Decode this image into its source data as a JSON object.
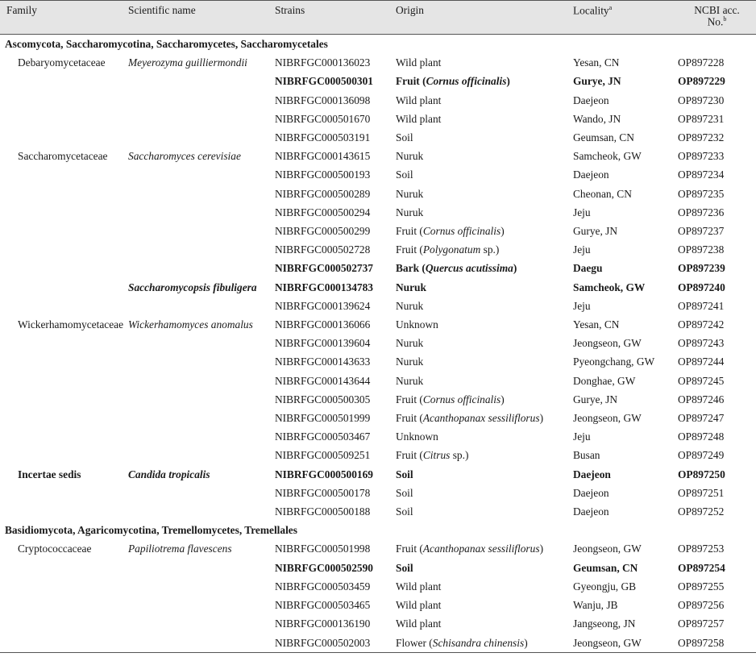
{
  "headers": {
    "family": "Family",
    "scientific": "Scientific name",
    "strains": "Strains",
    "origin": "Origin",
    "locality": "Locality",
    "locality_sup": "a",
    "ncbi_line1": "NCBI acc.",
    "ncbi_line2": "No.",
    "ncbi_sup": "b"
  },
  "groups": {
    "g1": "Ascomycota, Saccharomycotina, Saccharomycetes, Saccharomycetales",
    "g2": "Basidiomycota, Agaricomycotina, Tremellomycetes, Tremellales"
  },
  "rows": [
    {
      "family": "Debaryomycetaceae",
      "scientific": "Meyerozyma guilliermondii",
      "strain": "NIBRFGC000136023",
      "origin": "Wild plant",
      "origin_sp": "",
      "origin_end": "",
      "locality": "Yesan, CN",
      "acc": "OP897228"
    },
    {
      "family": "",
      "scientific": "",
      "strain": "NIBRFGC000500301",
      "origin": "Fruit (",
      "origin_sp": "Cornus officinalis",
      "origin_end": ")",
      "locality": "Gurye, JN",
      "acc": "OP897229"
    },
    {
      "family": "",
      "scientific": "",
      "strain": "NIBRFGC000136098",
      "origin": "Wild plant",
      "origin_sp": "",
      "origin_end": "",
      "locality": "Daejeon",
      "acc": "OP897230"
    },
    {
      "family": "",
      "scientific": "",
      "strain": "NIBRFGC000501670",
      "origin": "Wild plant",
      "origin_sp": "",
      "origin_end": "",
      "locality": "Wando, JN",
      "acc": "OP897231"
    },
    {
      "family": "",
      "scientific": "",
      "strain": "NIBRFGC000503191",
      "origin": "Soil",
      "origin_sp": "",
      "origin_end": "",
      "locality": "Geumsan, CN",
      "acc": "OP897232"
    },
    {
      "family": "Saccharomycetaceae",
      "scientific": "Saccharomyces cerevisiae",
      "strain": "NIBRFGC000143615",
      "origin": "Nuruk",
      "origin_sp": "",
      "origin_end": "",
      "locality": "Samcheok, GW",
      "acc": "OP897233"
    },
    {
      "family": "",
      "scientific": "",
      "strain": "NIBRFGC000500193",
      "origin": "Soil",
      "origin_sp": "",
      "origin_end": "",
      "locality": "Daejeon",
      "acc": "OP897234"
    },
    {
      "family": "",
      "scientific": "",
      "strain": "NIBRFGC000500289",
      "origin": "Nuruk",
      "origin_sp": "",
      "origin_end": "",
      "locality": "Cheonan, CN",
      "acc": "OP897235"
    },
    {
      "family": "",
      "scientific": "",
      "strain": "NIBRFGC000500294",
      "origin": "Nuruk",
      "origin_sp": "",
      "origin_end": "",
      "locality": "Jeju",
      "acc": "OP897236"
    },
    {
      "family": "",
      "scientific": "",
      "strain": "NIBRFGC000500299",
      "origin": "Fruit (",
      "origin_sp": "Cornus officinalis",
      "origin_end": ")",
      "locality": "Gurye, JN",
      "acc": "OP897237"
    },
    {
      "family": "",
      "scientific": "",
      "strain": "NIBRFGC000502728",
      "origin": "Fruit (",
      "origin_sp": "Polygonatum",
      "origin_end": " sp.)",
      "locality": "Jeju",
      "acc": "OP897238"
    },
    {
      "family": "",
      "scientific": "",
      "strain": "NIBRFGC000502737",
      "origin": "Bark (",
      "origin_sp": "Quercus acutissima",
      "origin_end": ")",
      "locality": "Daegu",
      "acc": "OP897239"
    },
    {
      "family": "",
      "scientific": "Saccharomycopsis fibuligera",
      "strain": "NIBRFGC000134783",
      "origin": "Nuruk",
      "origin_sp": "",
      "origin_end": "",
      "locality": "Samcheok, GW",
      "acc": "OP897240"
    },
    {
      "family": "",
      "scientific": "",
      "strain": "NIBRFGC000139624",
      "origin": "Nuruk",
      "origin_sp": "",
      "origin_end": "",
      "locality": "Jeju",
      "acc": "OP897241"
    },
    {
      "family": "Wickerhamomycetaceae",
      "scientific": "Wickerhamomyces anomalus",
      "strain": "NIBRFGC000136066",
      "origin": "Unknown",
      "origin_sp": "",
      "origin_end": "",
      "locality": "Yesan, CN",
      "acc": "OP897242"
    },
    {
      "family": "",
      "scientific": "",
      "strain": "NIBRFGC000139604",
      "origin": "Nuruk",
      "origin_sp": "",
      "origin_end": "",
      "locality": "Jeongseon, GW",
      "acc": "OP897243"
    },
    {
      "family": "",
      "scientific": "",
      "strain": "NIBRFGC000143633",
      "origin": "Nuruk",
      "origin_sp": "",
      "origin_end": "",
      "locality": "Pyeongchang, GW",
      "acc": "OP897244"
    },
    {
      "family": "",
      "scientific": "",
      "strain": "NIBRFGC000143644",
      "origin": "Nuruk",
      "origin_sp": "",
      "origin_end": "",
      "locality": "Donghae, GW",
      "acc": "OP897245"
    },
    {
      "family": "",
      "scientific": "",
      "strain": "NIBRFGC000500305",
      "origin": "Fruit (",
      "origin_sp": "Cornus officinalis",
      "origin_end": ")",
      "locality": "Gurye, JN",
      "acc": "OP897246"
    },
    {
      "family": "",
      "scientific": "",
      "strain": "NIBRFGC000501999",
      "origin": "Fruit (",
      "origin_sp": "Acanthopanax sessiliflorus",
      "origin_end": ")",
      "locality": "Jeongseon, GW",
      "acc": "OP897247"
    },
    {
      "family": "",
      "scientific": "",
      "strain": "NIBRFGC000503467",
      "origin": "Unknown",
      "origin_sp": "",
      "origin_end": "",
      "locality": "Jeju",
      "acc": "OP897248"
    },
    {
      "family": "",
      "scientific": "",
      "strain": "NIBRFGC000509251",
      "origin": "Fruit (",
      "origin_sp": "Citrus",
      "origin_end": " sp.)",
      "locality": "Busan",
      "acc": "OP897249"
    },
    {
      "family": "Incertae sedis",
      "scientific": "Candida tropicalis",
      "strain": "NIBRFGC000500169",
      "origin": "Soil",
      "origin_sp": "",
      "origin_end": "",
      "locality": "Daejeon",
      "acc": "OP897250"
    },
    {
      "family": "",
      "scientific": "",
      "strain": "NIBRFGC000500178",
      "origin": "Soil",
      "origin_sp": "",
      "origin_end": "",
      "locality": "Daejeon",
      "acc": "OP897251"
    },
    {
      "family": "",
      "scientific": "",
      "strain": "NIBRFGC000500188",
      "origin": "Soil",
      "origin_sp": "",
      "origin_end": "",
      "locality": "Daejeon",
      "acc": "OP897252"
    },
    {
      "family": "Cryptococcaceae",
      "scientific": "Papiliotrema flavescens",
      "strain": "NIBRFGC000501998",
      "origin": "Fruit (",
      "origin_sp": "Acanthopanax sessiliflorus",
      "origin_end": ")",
      "locality": "Jeongseon, GW",
      "acc": "OP897253"
    },
    {
      "family": "",
      "scientific": "",
      "strain": "NIBRFGC000502590",
      "origin": "Soil",
      "origin_sp": "",
      "origin_end": "",
      "locality": "Geumsan, CN",
      "acc": "OP897254"
    },
    {
      "family": "",
      "scientific": "",
      "strain": "NIBRFGC000503459",
      "origin": "Wild plant",
      "origin_sp": "",
      "origin_end": "",
      "locality": "Gyeongju, GB",
      "acc": "OP897255"
    },
    {
      "family": "",
      "scientific": "",
      "strain": "NIBRFGC000503465",
      "origin": "Wild plant",
      "origin_sp": "",
      "origin_end": "",
      "locality": "Wanju, JB",
      "acc": "OP897256"
    },
    {
      "family": "",
      "scientific": "",
      "strain": "NIBRFGC000136190",
      "origin": "Wild plant",
      "origin_sp": "",
      "origin_end": "",
      "locality": "Jangseong, JN",
      "acc": "OP897257"
    },
    {
      "family": "",
      "scientific": "",
      "strain": "NIBRFGC000502003",
      "origin": "Flower (",
      "origin_sp": "Schisandra chinensis",
      "origin_end": ")",
      "locality": "Jeongseon, GW",
      "acc": "OP897258"
    }
  ]
}
